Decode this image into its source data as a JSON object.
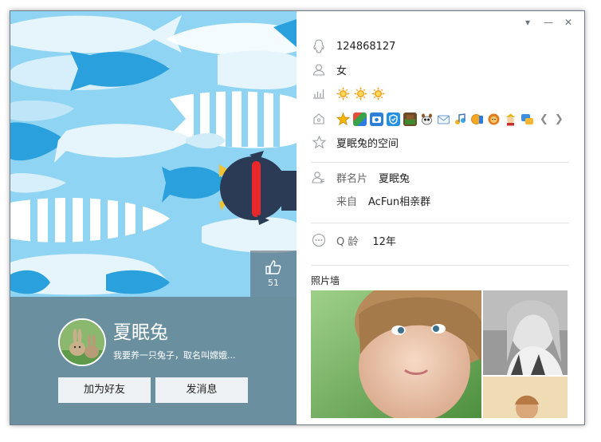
{
  "window": {
    "controls": {
      "menu": "▾",
      "minimize": "—",
      "close": "✕"
    }
  },
  "left": {
    "likes": "51",
    "nickname": "夏眠兔",
    "signature": "我要养一只兔子，取名叫嫦娥...",
    "buttons": {
      "add_friend": "加为好友",
      "send_message": "发消息"
    }
  },
  "right": {
    "qq_number": "124868127",
    "gender": "女",
    "level_icons": [
      "sun",
      "sun",
      "sun"
    ],
    "service_badges": [
      "star",
      "app-center",
      "camera",
      "shield",
      "game",
      "pet",
      "mail",
      "music",
      "gold",
      "lion",
      "warrior",
      "chat"
    ],
    "qzone": "夏眠兔的空间",
    "group_card_label": "群名片",
    "group_card_value": "夏眠兔",
    "from_label": "来自",
    "from_value": "AcFun相亲群",
    "qage_label": "Q 龄",
    "qage_value": "12年",
    "photo_wall_label": "照片墙"
  },
  "colors": {
    "cover_bg": "#7ecbf0",
    "profile_bg": "#6a909f",
    "fish_dark": "#2e9ed9",
    "fish_light": "#e8f6fd",
    "penguin": "#2b3a55",
    "scarf": "#e8282a"
  }
}
